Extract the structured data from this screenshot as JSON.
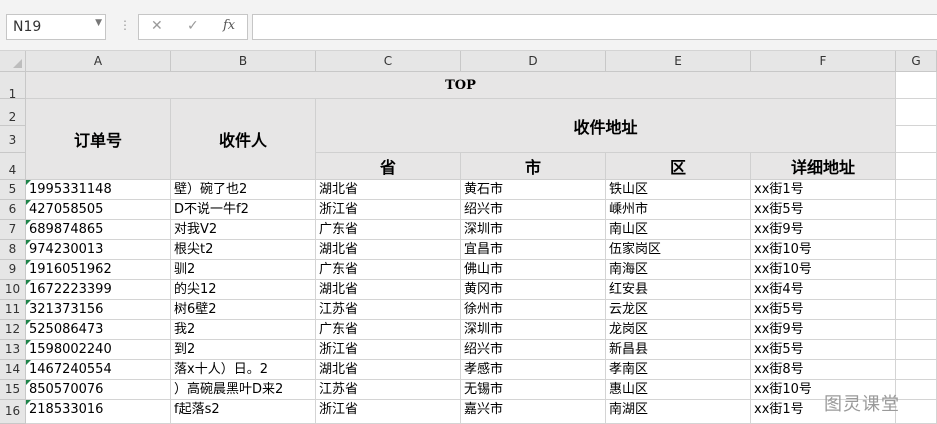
{
  "formula_bar": {
    "name_box": "N19",
    "cancel_icon": "✕",
    "enter_icon": "✓",
    "fx_label": "fx",
    "formula": ""
  },
  "columns": [
    "A",
    "B",
    "C",
    "D",
    "E",
    "F",
    "G"
  ],
  "rows": [
    "1",
    "2",
    "3",
    "4",
    "5",
    "6",
    "7",
    "8",
    "9",
    "10",
    "11",
    "12",
    "13",
    "14",
    "15",
    "16"
  ],
  "header": {
    "title": "TOP",
    "order_no": "订单号",
    "recipient": "收件人",
    "address": "收件地址",
    "province": "省",
    "city": "市",
    "district": "区",
    "detail": "详细地址"
  },
  "table_rows": [
    {
      "order": "1995331148",
      "name": "壁）碗了也2",
      "province": "湖北省",
      "city": "黄石市",
      "district": "铁山区",
      "detail": "xx街1号"
    },
    {
      "order": "427058505",
      "name": "D不说一牛f2",
      "province": "浙江省",
      "city": "绍兴市",
      "district": "嵊州市",
      "detail": "xx街5号"
    },
    {
      "order": "689874865",
      "name": "对我V2",
      "province": "广东省",
      "city": "深圳市",
      "district": "南山区",
      "detail": "xx街9号"
    },
    {
      "order": "974230013",
      "name": "根尖t2",
      "province": "湖北省",
      "city": "宜昌市",
      "district": "伍家岗区",
      "detail": "xx街10号"
    },
    {
      "order": "1916051962",
      "name": "驯2",
      "province": "广东省",
      "city": "佛山市",
      "district": "南海区",
      "detail": "xx街10号"
    },
    {
      "order": "1672223399",
      "name": "的尖12",
      "province": "湖北省",
      "city": "黄冈市",
      "district": "红安县",
      "detail": "xx街4号"
    },
    {
      "order": "321373156",
      "name": "树6壁2",
      "province": "江苏省",
      "city": "徐州市",
      "district": "云龙区",
      "detail": "xx街5号"
    },
    {
      "order": "525086473",
      "name": "我2",
      "province": "广东省",
      "city": "深圳市",
      "district": "龙岗区",
      "detail": "xx街9号"
    },
    {
      "order": "1598002240",
      "name": "到2",
      "province": "浙江省",
      "city": "绍兴市",
      "district": "新昌县",
      "detail": "xx街5号"
    },
    {
      "order": "1467240554",
      "name": "落x十人）日。2",
      "province": "湖北省",
      "city": "孝感市",
      "district": "孝南区",
      "detail": "xx街8号"
    },
    {
      "order": "850570076",
      "name": "）高碗晨黑叶D来2",
      "province": "江苏省",
      "city": "无锡市",
      "district": "惠山区",
      "detail": "xx街10号"
    },
    {
      "order": "218533016",
      "name": "f起落s2",
      "province": "浙江省",
      "city": "嘉兴市",
      "district": "南湖区",
      "detail": "xx街1号"
    }
  ],
  "watermark": "图灵课堂",
  "colors": {
    "header_fill": "#e7e6e6",
    "grid": "#d4d4d4",
    "error_marker": "#1e8449"
  }
}
